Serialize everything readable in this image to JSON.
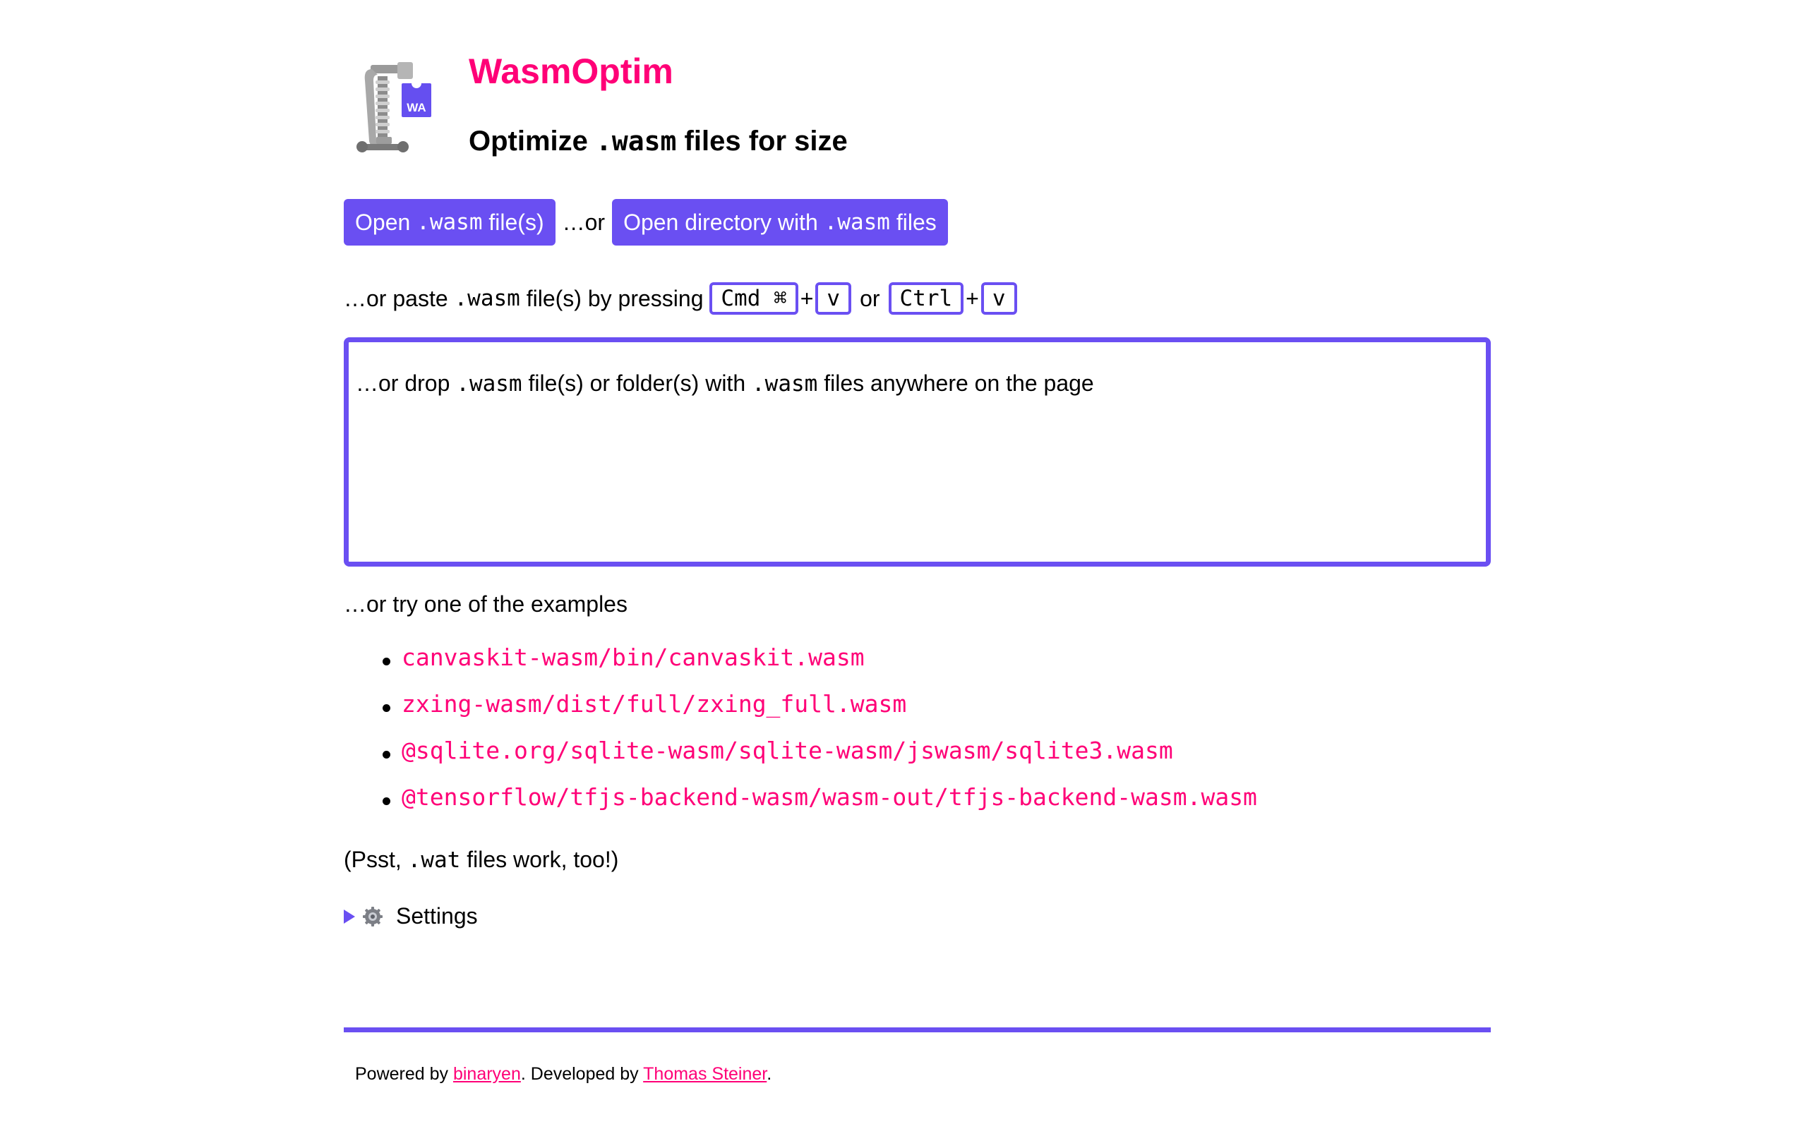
{
  "header": {
    "title": "WasmOptim",
    "subtitle_before": "Optimize ",
    "subtitle_code": ".wasm",
    "subtitle_after": " files for size",
    "logo_badge": "WA"
  },
  "actions": {
    "open_files": {
      "before": "Open ",
      "code": ".wasm",
      "after": " file(s)"
    },
    "or_text": "…or",
    "open_directory": {
      "before": "Open directory with ",
      "code": ".wasm",
      "after": " files"
    }
  },
  "paste": {
    "before": "…or paste ",
    "code": ".wasm",
    "after": " file(s) by pressing ",
    "keys_mac": [
      "Cmd ⌘",
      "v"
    ],
    "or_text": "or",
    "keys_other": [
      "Ctrl",
      "v"
    ],
    "plus": "+"
  },
  "dropzone": {
    "before": "…or drop ",
    "code1": ".wasm",
    "middle": " file(s) or folder(s) with ",
    "code2": ".wasm",
    "after": " files anywhere on the page"
  },
  "examples": {
    "intro": "…or try one of the examples",
    "items": [
      "canvaskit-wasm/bin/canvaskit.wasm",
      "zxing-wasm/dist/full/zxing_full.wasm",
      "@sqlite.org/sqlite-wasm/sqlite-wasm/jswasm/sqlite3.wasm",
      "@tensorflow/tfjs-backend-wasm/wasm-out/tfjs-backend-wasm.wasm"
    ]
  },
  "psst": {
    "before": "(Psst, ",
    "code": ".wat",
    "after": " files work, too!)"
  },
  "settings": {
    "label": "Settings"
  },
  "footer": {
    "powered_by": "Powered by ",
    "binaryen": "binaryen",
    "developed_by": ". Developed by ",
    "author": "Thomas Steiner",
    "end": "."
  },
  "colors": {
    "accent": "#6a4ff2",
    "brand": "#ff0077"
  }
}
